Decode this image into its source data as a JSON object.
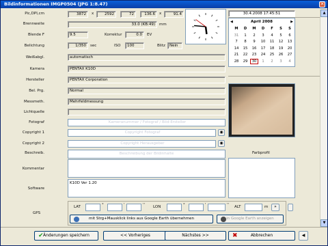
{
  "window": {
    "title": "Bildinformationen IMGP0504 (JPG 1:8.47)",
    "close_glyph": "✕"
  },
  "labels": {
    "pic_dpi": "Pic,DPI,cm",
    "x1": "x",
    "x2": "x",
    "brennweite": "Brennweite",
    "mm": "mm",
    "blende": "Blende F",
    "korrektur": "Korrektur",
    "ev": "EV",
    "belichtung": "Belichtung",
    "sec": "sec",
    "iso": "ISO",
    "blitz": "Blitz",
    "weissabgl": "Weißabgl.",
    "kamera": "Kamera",
    "hersteller": "Hersteller",
    "bel_prg": "Bel. Prg.",
    "messmeth": "Messmeth.",
    "lichtquelle": "Lichtquelle",
    "fotograf": "Fotograf",
    "copyright1": "Copyright 1",
    "copyright2": "Copyright 2",
    "beschreib": "Beschreib.",
    "farbprofil": "Farbprofil",
    "kommentar": "Kommentar",
    "software": "Software",
    "gps": "GPS",
    "lat": "LAT",
    "lon": "LON",
    "alt": "ALT",
    "m": "m",
    "deg1": "°",
    "min1": "'",
    "sec1": "''",
    "deg2": "°",
    "min2": "'",
    "sec2": "''"
  },
  "values": {
    "width": "3872",
    "height": "2592",
    "dpi": "72",
    "cm_w": "136.6",
    "cm_h": "91.4",
    "brennweite": "33.0 (KB:49)",
    "blende": "9.5",
    "korrektur": "0.0",
    "belichtung": "1/350",
    "iso": "100",
    "blitz": "Nein",
    "weissabgl": "automatisch",
    "kamera": "PENTAX K10D",
    "hersteller": "PENTAX Corporation",
    "bel_prg": "Normal",
    "messmeth": "Mehrfeldmessung",
    "lichtquelle": "",
    "software": "K10D Ver 1.20"
  },
  "placeholders": {
    "fotograf": "Kameranummer / Fotograf / Bild-Ersteller",
    "copyright1": "Copyright Fotograf",
    "copyright2": "Copyright Herausgeber",
    "beschreib": "Beschreibung der Bildinhalte"
  },
  "icons": {
    "eye": "◉",
    "gps_arrow": "»",
    "calendar_prev": "◀",
    "calendar_next": "▶",
    "scroll_up": "▲",
    "scroll_down": "▼",
    "bottom_left": "◀"
  },
  "datetime": "30.4.2008 17:45:51",
  "clock": {
    "hour": 17,
    "minute": 45,
    "second": 51
  },
  "calendar": {
    "month": "April 2008",
    "weekdays": [
      "M",
      "D",
      "M",
      "D",
      "F",
      "S",
      "S"
    ],
    "weeks": [
      [
        "31",
        "1",
        "2",
        "3",
        "4",
        "5",
        "6"
      ],
      [
        "7",
        "8",
        "9",
        "10",
        "11",
        "12",
        "13"
      ],
      [
        "14",
        "15",
        "16",
        "17",
        "18",
        "19",
        "20"
      ],
      [
        "21",
        "22",
        "23",
        "24",
        "25",
        "26",
        "27"
      ],
      [
        "28",
        "29",
        "30",
        "1",
        "2",
        "3",
        "4"
      ]
    ],
    "other_month": [
      [
        0
      ],
      [],
      [],
      [],
      [
        3,
        4,
        5,
        6
      ]
    ],
    "today": [
      4,
      2
    ]
  },
  "buttons": {
    "google_earth_take": "mit Strg+Mausklick links aus Google Earth übernehmen",
    "google_earth_show": "in Google Earth anzeigen",
    "save": "Änderungen speichern",
    "prev": "<< Vorheriges",
    "next": "Nächstes >>",
    "cancel": "Abbrechen"
  },
  "colors": {
    "titlebar": "#0a3fa8",
    "today_border": "#c00000",
    "save_check": "#1a9a1a",
    "cancel_x": "#c00000"
  }
}
